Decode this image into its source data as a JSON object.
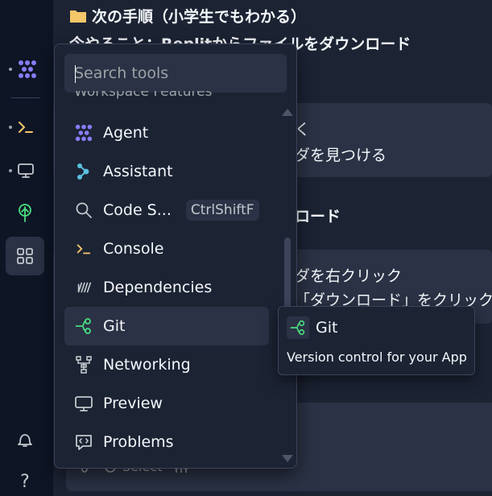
{
  "background": {
    "title": "次の手順（小学生でもわかる）",
    "subtitle": "今やること：Replitからファイルをダウンロード",
    "fragment_1": "く",
    "fragment_2": "ダを見つける",
    "fragment_3": "ロード",
    "fragment_4": "ダを右クリック",
    "fragment_5": "「ダウンロード」をクリック",
    "footer_select_label": "Select"
  },
  "search": {
    "placeholder": "Search tools"
  },
  "section_header": "Workspace Features",
  "menu": {
    "items": [
      {
        "label": "Agent",
        "icon": "agent-icon"
      },
      {
        "label": "Assistant",
        "icon": "assistant-icon"
      },
      {
        "label": "Code S...",
        "icon": "search-icon",
        "shortcut": "CtrlShiftF"
      },
      {
        "label": "Console",
        "icon": "console-icon"
      },
      {
        "label": "Dependencies",
        "icon": "dependencies-icon"
      },
      {
        "label": "Git",
        "icon": "git-icon"
      },
      {
        "label": "Networking",
        "icon": "networking-icon"
      },
      {
        "label": "Preview",
        "icon": "preview-icon"
      },
      {
        "label": "Problems",
        "icon": "problems-icon"
      }
    ],
    "hovered_index": 5
  },
  "tooltip": {
    "title": "Git",
    "description": "Version control for your App"
  },
  "rail": {
    "help_label": "?"
  },
  "colors": {
    "background": "#0e1525",
    "panel": "#1c2333",
    "surface": "#2b3245",
    "border": "#3c445c",
    "agent_purple": "#8a7cf8",
    "assistant_teal": "#5bc0de",
    "console_yellow": "#f5c76b",
    "git_green": "#4ade80",
    "text": "#f5f9fc",
    "muted": "#9da2a6"
  }
}
